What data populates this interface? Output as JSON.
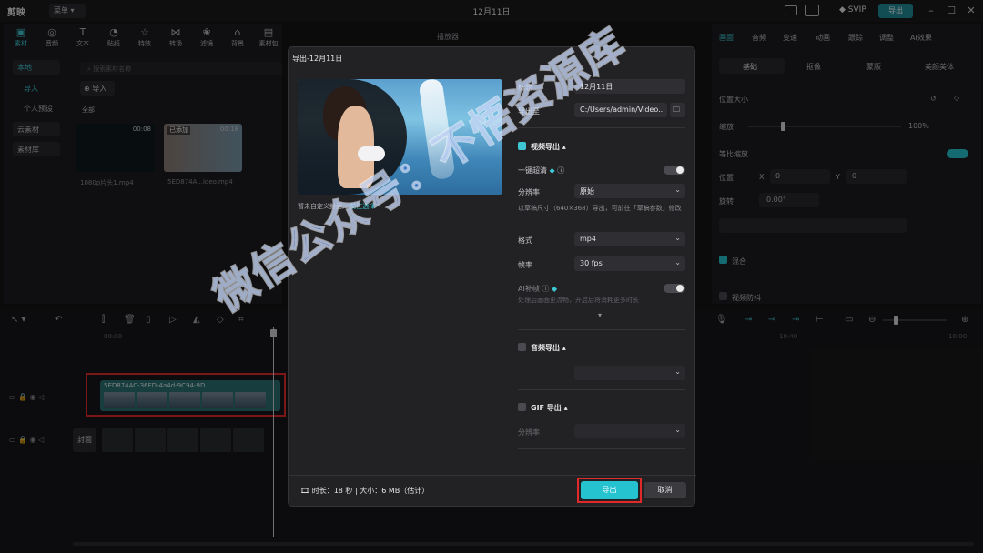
{
  "app": {
    "name": "剪映",
    "menu_label": "菜单",
    "window_title": "12月11日",
    "svip": "SVIP",
    "export_top": "导出"
  },
  "left_panel": {
    "tools": [
      "素材",
      "音频",
      "文本",
      "贴纸",
      "特效",
      "转场",
      "滤镜",
      "背景",
      "素材包"
    ],
    "nav": {
      "local": "本地",
      "import": "导入",
      "personal_presets": "个人预设",
      "cloud": "云素材",
      "library": "素材库"
    },
    "search_placeholder": "搜索素材名称",
    "import_button": "导入",
    "section_all": "全部",
    "media": [
      {
        "name": "1080p片头1.mp4",
        "duration": "00:08",
        "badge": ""
      },
      {
        "name": "5ED874A...ideo.mp4",
        "duration": "00:18",
        "badge": "已添加"
      }
    ]
  },
  "player": {
    "label": "播放器"
  },
  "right_panel": {
    "tabs": [
      "画面",
      "音频",
      "变速",
      "动画",
      "跟踪",
      "调整",
      "AI效果"
    ],
    "subtabs": [
      "基础",
      "抠像",
      "蒙版",
      "美颜美体"
    ],
    "position_size": "位置大小",
    "scale_label": "缩放",
    "scale_value": "100%",
    "uniform_scale": "等比缩放",
    "position_label": "位置",
    "x_label": "X",
    "x_value": "0",
    "y_label": "Y",
    "y_value": "0",
    "rotate_label": "旋转",
    "rotate_value": "0.00°",
    "blend_label": "混合",
    "stabilize_label": "视频防抖"
  },
  "timeline": {
    "ruler_start": "00:00",
    "ruler_mid": "10:40",
    "ruler_end": "10:00",
    "clip_title": "5ED874AC-36FD-4a4d-9C94-9D",
    "cover_label": "封面",
    "add_audio_hint": "加载音乐歌词"
  },
  "dialog": {
    "title": "导出-12月11日",
    "cover_hint": "暂未自定义封面,",
    "cover_link": "前往选择",
    "title_label": "标题",
    "title_value": "12月11日",
    "export_to_label": "导出至",
    "export_to_value": "C:/Users/admin/Video...",
    "video_export": "视频导出",
    "hq_label": "一键超清",
    "resolution_label": "分辨率",
    "resolution_value": "原始",
    "resolution_note": "以草稿尺寸（640×368）导出，可前往「草稿参数」修改",
    "format_label": "格式",
    "format_value": "mp4",
    "fps_label": "帧率",
    "fps_value": "30 fps",
    "ai_frame_label": "AI补帧",
    "ai_frame_note": "处理后画面更流畅，开启后将消耗更多时长",
    "audio_export": "音频导出",
    "gif_export": "GIF 导出",
    "gif_resolution_label": "分辨率",
    "duration_text": "时长：18 秒 | 大小：6 MB（估计）",
    "export_button": "导出",
    "cancel_button": "取消"
  },
  "watermark": "微信公众号：不悟资源库",
  "colors": {
    "accent": "#25c3d0",
    "highlight": "#e02a2a",
    "panel": "#1c1c1f"
  }
}
